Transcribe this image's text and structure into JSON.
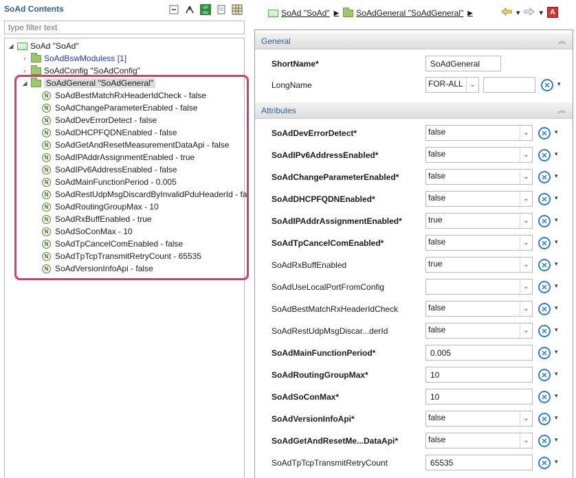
{
  "left": {
    "title": "SoAd Contents",
    "tools": [
      "collapse-all-icon",
      "link-icon",
      "vp-res-icon",
      "page-icon",
      "grid-icon"
    ],
    "filter_placeholder": "type filter text",
    "tree": {
      "root": "SoAd \"SoAd\"",
      "children": [
        {
          "label": "SoAdBswModuless [1]",
          "collapsed": true
        },
        {
          "label": "SoAdConfig \"SoAdConfig\"",
          "collapsed": true
        },
        {
          "label": "SoAdGeneral \"SoAdGeneral\"",
          "collapsed": false,
          "selected": true
        }
      ],
      "general_params": [
        "SoAdBestMatchRxHeaderIdCheck - false",
        "SoAdChangeParameterEnabled - false",
        "SoAdDevErrorDetect - false",
        "SoAdDHCPFQDNEnabled - false",
        "SoAdGetAndResetMeasurementDataApi - false",
        "SoAdIPAddrAssignmentEnabled - true",
        "SoAdIPv6AddressEnabled - false",
        "SoAdMainFunctionPeriod - 0.005",
        "SoAdRestUdpMsgDiscardByInvalidPduHeaderId - fa",
        "SoAdRoutingGroupMax - 10",
        "SoAdRxBuffEnabled - true",
        "SoAdSoConMax - 10",
        "SoAdTpCancelComEnabled - false",
        "SoAdTpTcpTransmitRetryCount - 65535",
        "SoAdVersionInfoApi - false"
      ],
      "param_icon_letter": "N"
    }
  },
  "right": {
    "breadcrumb": [
      "SoAd \"SoAd\"",
      "SoAdGeneral \"SoAdGeneral\""
    ],
    "nav_icon_names": [
      "back-arrow-icon",
      "forward-arrow-icon",
      "red-a-icon"
    ],
    "red_a": "A",
    "general": {
      "title": "General",
      "short_name_label": "ShortName*",
      "short_name_value": "SoAdGeneral",
      "long_name_label": "LongName",
      "long_name_lang": "FOR-ALL",
      "long_name_value": ""
    },
    "attributes": {
      "title": "Attributes",
      "rows": [
        {
          "label": "SoAdDevErrorDetect*",
          "value": "false",
          "kind": "dropdown",
          "bold": true
        },
        {
          "label": "SoAdIPv6AddressEnabled*",
          "value": "false",
          "kind": "dropdown",
          "bold": true
        },
        {
          "label": "SoAdChangeParameterEnabled*",
          "value": "false",
          "kind": "dropdown",
          "bold": true
        },
        {
          "label": "SoAdDHCPFQDNEnabled*",
          "value": "false",
          "kind": "dropdown",
          "bold": true
        },
        {
          "label": "SoAdIPAddrAssignmentEnabled*",
          "value": "true",
          "kind": "dropdown",
          "bold": true
        },
        {
          "label": "SoAdTpCancelComEnabled*",
          "value": "false",
          "kind": "dropdown",
          "bold": true
        },
        {
          "label": "SoAdRxBuffEnabled",
          "value": "true",
          "kind": "dropdown",
          "bold": false
        },
        {
          "label": "SoAdUseLocalPortFromConfig",
          "value": "",
          "kind": "dropdown",
          "bold": false
        },
        {
          "label": "SoAdBestMatchRxHeaderIdCheck",
          "value": "false",
          "kind": "dropdown",
          "bold": false
        },
        {
          "label": "SoAdRestUdpMsgDiscar...derId",
          "value": "false",
          "kind": "dropdown",
          "bold": false
        },
        {
          "label": "SoAdMainFunctionPeriod*",
          "value": "0.005",
          "kind": "text",
          "bold": true
        },
        {
          "label": "SoAdRoutingGroupMax*",
          "value": "10",
          "kind": "text",
          "bold": true
        },
        {
          "label": "SoAdSoConMax*",
          "value": "10",
          "kind": "text",
          "bold": true
        },
        {
          "label": "SoAdVersionInfoApi*",
          "value": "false",
          "kind": "dropdown",
          "bold": true
        },
        {
          "label": "SoAdGetAndResetMe...DataApi*",
          "value": "false",
          "kind": "dropdown",
          "bold": true
        },
        {
          "label": "SoAdTpTcpTransmitRetryCount",
          "value": "65535",
          "kind": "text",
          "bold": false
        }
      ]
    }
  },
  "colors": {
    "title_blue": "#2a5e9a",
    "highlight_pink": "#e8336f",
    "action_blue": "#2f7ec8",
    "link_blue": "#2233cc"
  }
}
